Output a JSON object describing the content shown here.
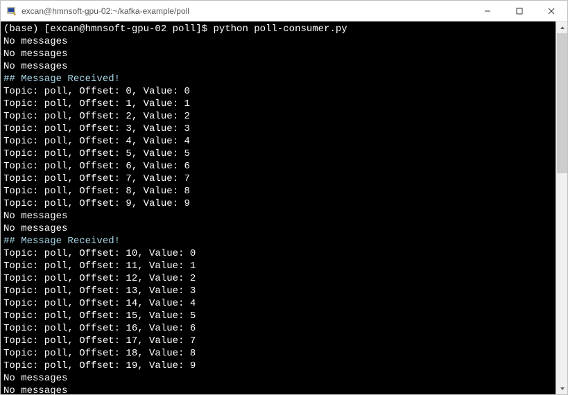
{
  "window": {
    "title": "excan@hmnsoft-gpu-02:~/kafka-example/poll"
  },
  "terminal": {
    "prompt": "(base) [excan@hmnsoft-gpu-02 poll]$ ",
    "command": "python poll-consumer.py",
    "lines": [
      {
        "text": "No messages",
        "cls": ""
      },
      {
        "text": "No messages",
        "cls": ""
      },
      {
        "text": "No messages",
        "cls": ""
      },
      {
        "text": "## Message Received!",
        "cls": "received-header"
      },
      {
        "text": "Topic: poll, Offset: 0, Value: 0",
        "cls": ""
      },
      {
        "text": "Topic: poll, Offset: 1, Value: 1",
        "cls": ""
      },
      {
        "text": "Topic: poll, Offset: 2, Value: 2",
        "cls": ""
      },
      {
        "text": "Topic: poll, Offset: 3, Value: 3",
        "cls": ""
      },
      {
        "text": "Topic: poll, Offset: 4, Value: 4",
        "cls": ""
      },
      {
        "text": "Topic: poll, Offset: 5, Value: 5",
        "cls": ""
      },
      {
        "text": "Topic: poll, Offset: 6, Value: 6",
        "cls": ""
      },
      {
        "text": "Topic: poll, Offset: 7, Value: 7",
        "cls": ""
      },
      {
        "text": "Topic: poll, Offset: 8, Value: 8",
        "cls": ""
      },
      {
        "text": "Topic: poll, Offset: 9, Value: 9",
        "cls": ""
      },
      {
        "text": "No messages",
        "cls": ""
      },
      {
        "text": "No messages",
        "cls": ""
      },
      {
        "text": "## Message Received!",
        "cls": "received-header"
      },
      {
        "text": "Topic: poll, Offset: 10, Value: 0",
        "cls": ""
      },
      {
        "text": "Topic: poll, Offset: 11, Value: 1",
        "cls": ""
      },
      {
        "text": "Topic: poll, Offset: 12, Value: 2",
        "cls": ""
      },
      {
        "text": "Topic: poll, Offset: 13, Value: 3",
        "cls": ""
      },
      {
        "text": "Topic: poll, Offset: 14, Value: 4",
        "cls": ""
      },
      {
        "text": "Topic: poll, Offset: 15, Value: 5",
        "cls": ""
      },
      {
        "text": "Topic: poll, Offset: 16, Value: 6",
        "cls": ""
      },
      {
        "text": "Topic: poll, Offset: 17, Value: 7",
        "cls": ""
      },
      {
        "text": "Topic: poll, Offset: 18, Value: 8",
        "cls": ""
      },
      {
        "text": "Topic: poll, Offset: 19, Value: 9",
        "cls": ""
      },
      {
        "text": "No messages",
        "cls": ""
      },
      {
        "text": "No messages",
        "cls": ""
      }
    ]
  }
}
